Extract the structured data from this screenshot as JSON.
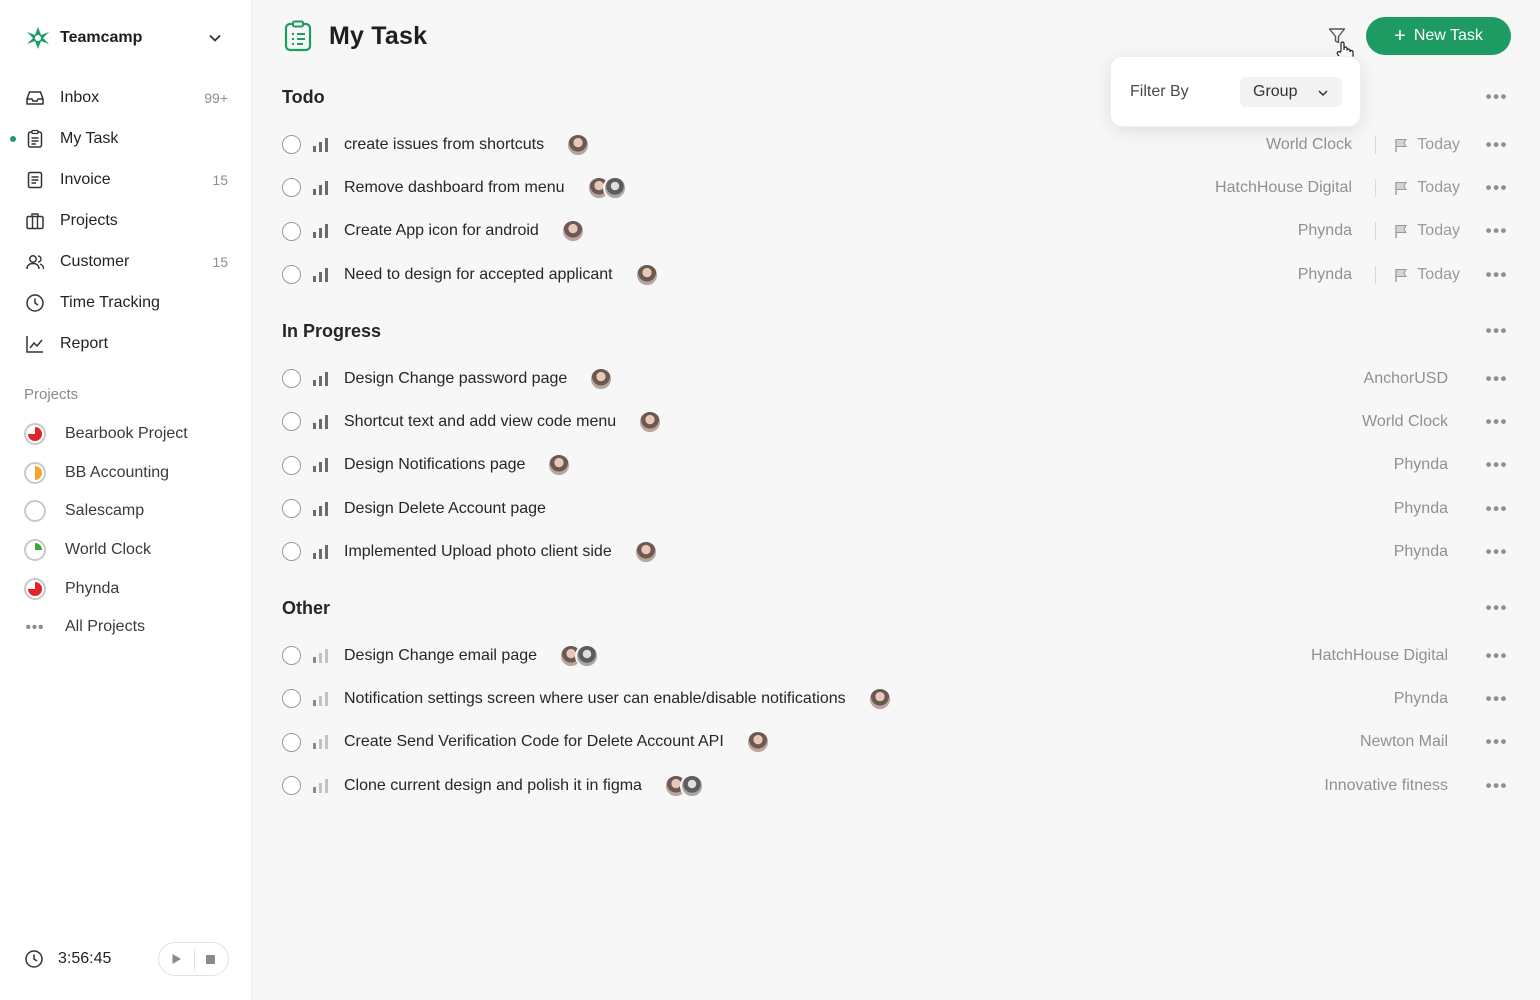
{
  "workspace": {
    "name": "Teamcamp"
  },
  "nav": [
    {
      "label": "Inbox",
      "count": "99+",
      "icon": "inbox-icon"
    },
    {
      "label": "My Task",
      "count": "",
      "icon": "clipboard-icon",
      "active": true
    },
    {
      "label": "Invoice",
      "count": "15",
      "icon": "invoice-icon"
    },
    {
      "label": "Projects",
      "count": "",
      "icon": "briefcase-icon"
    },
    {
      "label": "Customer",
      "count": "15",
      "icon": "users-icon"
    },
    {
      "label": "Time Tracking",
      "count": "",
      "icon": "clock-icon"
    },
    {
      "label": "Report",
      "count": "",
      "icon": "chart-line-icon"
    }
  ],
  "projects": {
    "title": "Projects",
    "items": [
      {
        "label": "Bearbook Project",
        "color": "#e0242a",
        "progress": 0.75
      },
      {
        "label": "BB Accounting",
        "color": "#f2a62a",
        "progress": 0.5
      },
      {
        "label": "Salescamp",
        "color": "#bdbdbd",
        "progress": 0.0
      },
      {
        "label": "World Clock",
        "color": "#3aa83a",
        "progress": 0.25
      },
      {
        "label": "Phynda",
        "color": "#e0242a",
        "progress": 0.75
      }
    ],
    "all_label": "All Projects"
  },
  "timer": {
    "time": "3:56:45"
  },
  "header": {
    "title": "My Task",
    "new_task_label": "New Task"
  },
  "filter": {
    "label": "Filter By",
    "value": "Group"
  },
  "colors": {
    "accent": "#1e9b63"
  },
  "groups": [
    {
      "title": "Todo",
      "tasks": [
        {
          "name": "create issues from shortcuts",
          "avatars": 1,
          "project": "World Clock",
          "due": "Today",
          "priority": "high"
        },
        {
          "name": "Remove dashboard from menu",
          "avatars": 2,
          "project": "HatchHouse Digital",
          "due": "Today",
          "priority": "high"
        },
        {
          "name": "Create App icon for android",
          "avatars": 1,
          "project": "Phynda",
          "due": "Today",
          "priority": "high"
        },
        {
          "name": "Need to design for accepted applicant",
          "avatars": 1,
          "project": "Phynda",
          "due": "Today",
          "priority": "high"
        }
      ]
    },
    {
      "title": "In Progress",
      "tasks": [
        {
          "name": "Design Change password page",
          "avatars": 1,
          "project": "AnchorUSD",
          "due": "",
          "priority": "high"
        },
        {
          "name": "Shortcut text and add view code menu",
          "avatars": 1,
          "project": "World Clock",
          "due": "",
          "priority": "high"
        },
        {
          "name": "Design Notifications page",
          "avatars": 1,
          "project": "Phynda",
          "due": "",
          "priority": "high"
        },
        {
          "name": "Design Delete Account page",
          "avatars": 0,
          "project": "Phynda",
          "due": "",
          "priority": "high"
        },
        {
          "name": "Implemented Upload photo client side",
          "avatars": 1,
          "project": "Phynda",
          "due": "",
          "priority": "high"
        }
      ]
    },
    {
      "title": "Other",
      "tasks": [
        {
          "name": "Design Change email page",
          "avatars": 2,
          "project": "HatchHouse Digital",
          "due": "",
          "priority": "low"
        },
        {
          "name": "Notification settings screen where user can enable/disable notifications",
          "avatars": 1,
          "project": "Phynda",
          "due": "",
          "priority": "low"
        },
        {
          "name": "Create Send Verification Code for Delete Account API",
          "avatars": 1,
          "project": "Newton Mail",
          "due": "",
          "priority": "low"
        },
        {
          "name": "Clone current design and polish it in figma",
          "avatars": 2,
          "project": "Innovative fitness",
          "due": "",
          "priority": "low"
        }
      ]
    }
  ]
}
